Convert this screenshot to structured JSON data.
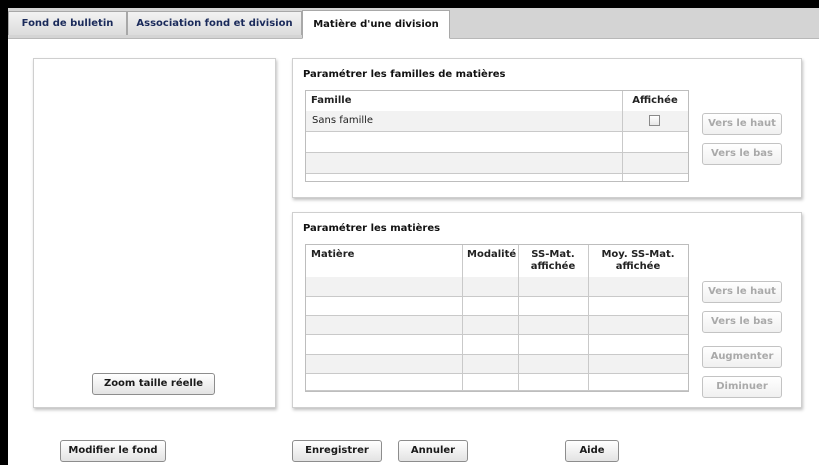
{
  "tabs": [
    {
      "label": "Fond de bulletin"
    },
    {
      "label": "Association fond et division"
    },
    {
      "label": "Matière d'une division"
    }
  ],
  "active_tab": 2,
  "preview": {
    "zoom_button": "Zoom taille réelle"
  },
  "familles": {
    "title": "Paramétrer les familles de matières",
    "columns": [
      "Famille",
      "Affichée"
    ],
    "rows": [
      {
        "famille": "Sans famille",
        "affichee": false
      }
    ],
    "buttons": {
      "up": "Vers le haut",
      "down": "Vers le bas"
    }
  },
  "matieres": {
    "title": "Paramétrer les matières",
    "columns": [
      "Matière",
      "Modalité",
      "SS-Mat. affichée",
      "Moy. SS-Mat. affichée"
    ],
    "rows": [],
    "buttons": {
      "up": "Vers le haut",
      "down": "Vers le bas",
      "increase": "Augmenter",
      "decrease": "Diminuer"
    }
  },
  "footer": {
    "modify": "Modifier le fond",
    "save": "Enregistrer",
    "cancel": "Annuler",
    "help": "Aide"
  }
}
